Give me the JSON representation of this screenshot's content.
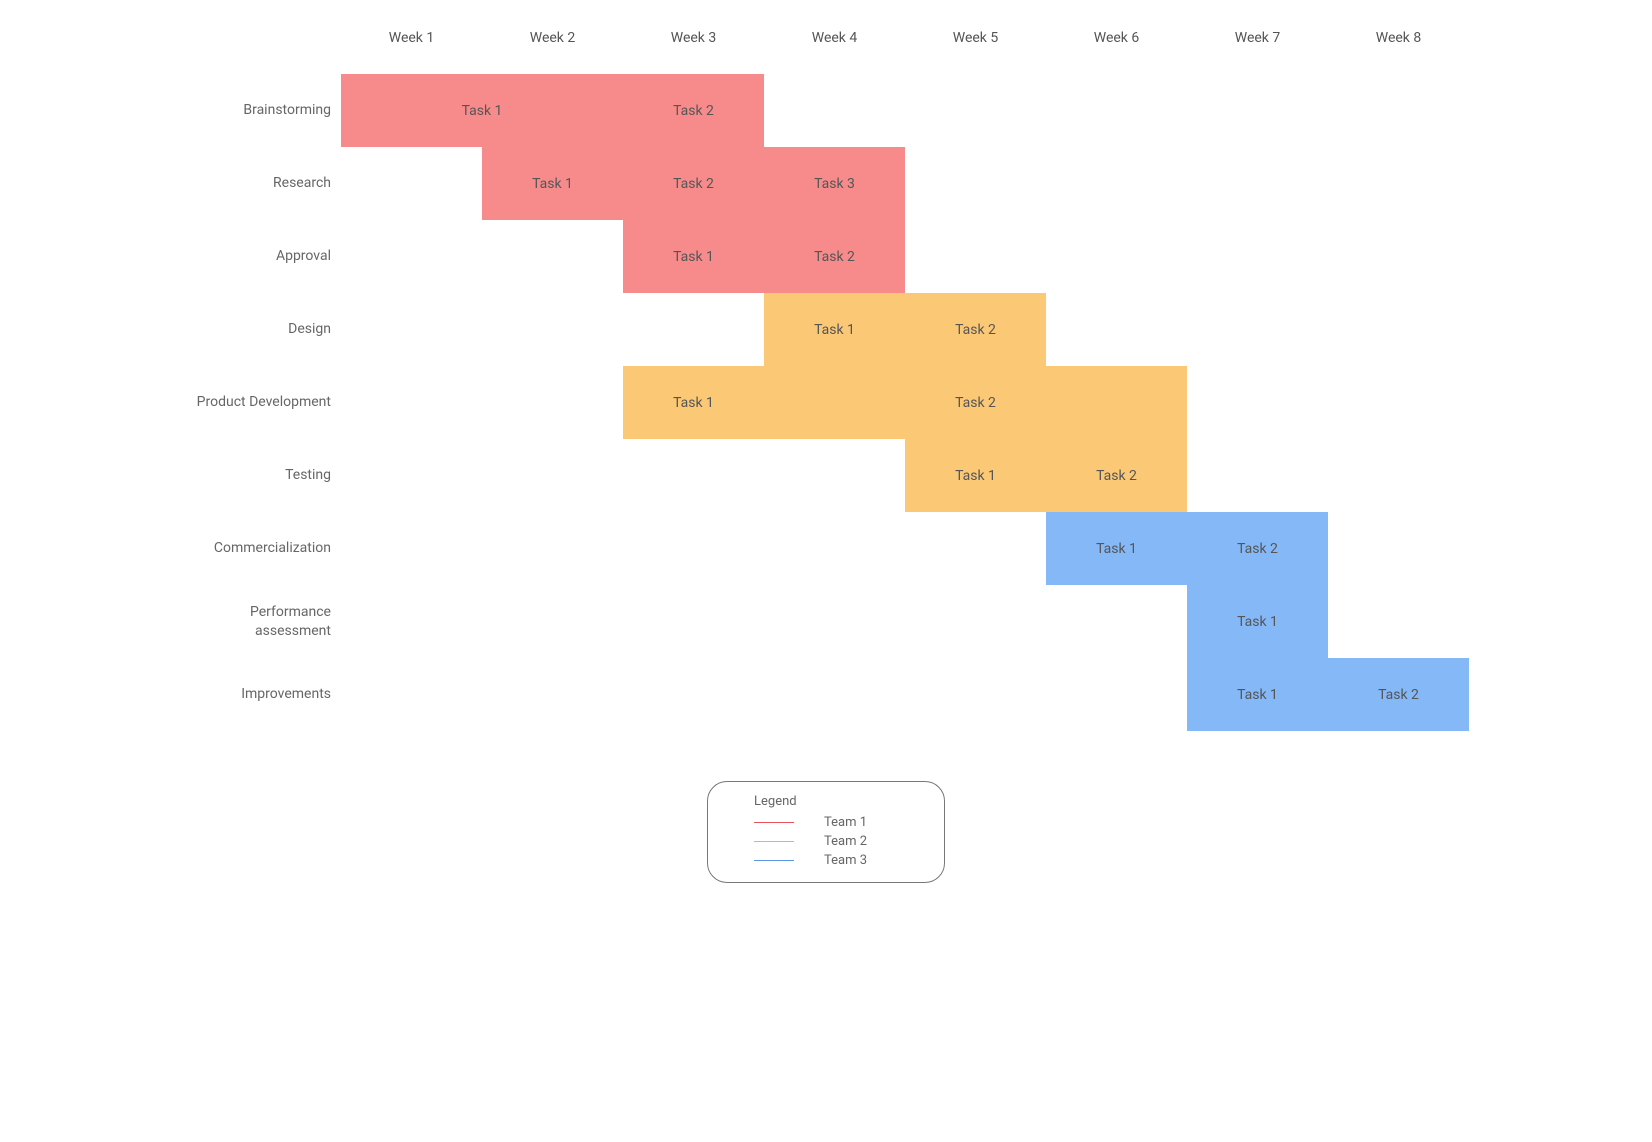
{
  "chart_data": {
    "type": "bar",
    "title": "",
    "xlabel": "",
    "ylabel": "",
    "x_categories": [
      "Week 1",
      "Week 2",
      "Week 3",
      "Week 4",
      "Week 5",
      "Week 6",
      "Week  7",
      "Week 8"
    ],
    "y_categories": [
      "Brainstorming",
      "Research",
      "Approval",
      "Design",
      "Product Development",
      "Testing",
      "Commercialization",
      "Performance assessment",
      "Improvements"
    ],
    "legend": {
      "title": "Legend",
      "items": [
        "Team 1",
        "Team 2",
        "Team 3"
      ]
    },
    "series": [
      {
        "row": "Brainstorming",
        "task": "Task 1",
        "team": "Team 1",
        "start_week": 1,
        "span_weeks": 2
      },
      {
        "row": "Brainstorming",
        "task": "Task 2",
        "team": "Team 1",
        "start_week": 3,
        "span_weeks": 1
      },
      {
        "row": "Research",
        "task": "Task 1",
        "team": "Team 1",
        "start_week": 2,
        "span_weeks": 1
      },
      {
        "row": "Research",
        "task": "Task 2",
        "team": "Team 1",
        "start_week": 3,
        "span_weeks": 1
      },
      {
        "row": "Research",
        "task": "Task 3",
        "team": "Team 1",
        "start_week": 4,
        "span_weeks": 1
      },
      {
        "row": "Approval",
        "task": "Task 1",
        "team": "Team 1",
        "start_week": 3,
        "span_weeks": 1
      },
      {
        "row": "Approval",
        "task": "Task 2",
        "team": "Team 1",
        "start_week": 4,
        "span_weeks": 1
      },
      {
        "row": "Design",
        "task": "Task 1",
        "team": "Team 2",
        "start_week": 4,
        "span_weeks": 1
      },
      {
        "row": "Design",
        "task": "Task 2",
        "team": "Team 2",
        "start_week": 5,
        "span_weeks": 1
      },
      {
        "row": "Product Development",
        "task": "Task 1",
        "team": "Team 2",
        "start_week": 3,
        "span_weeks": 1
      },
      {
        "row": "Product Development",
        "task": "Task 2",
        "team": "Team 2",
        "start_week": 4,
        "span_weeks": 3
      },
      {
        "row": "Testing",
        "task": "Task 1",
        "team": "Team 2",
        "start_week": 5,
        "span_weeks": 1
      },
      {
        "row": "Testing",
        "task": "Task 2",
        "team": "Team 2",
        "start_week": 6,
        "span_weeks": 1
      },
      {
        "row": "Commercialization",
        "task": "Task 1",
        "team": "Team 3",
        "start_week": 6,
        "span_weeks": 1
      },
      {
        "row": "Commercialization",
        "task": "Task 2",
        "team": "Team 3",
        "start_week": 7,
        "span_weeks": 1
      },
      {
        "row": "Performance assessment",
        "task": "Task 1",
        "team": "Team 3",
        "start_week": 7,
        "span_weeks": 1
      },
      {
        "row": "Improvements",
        "task": "Task 1",
        "team": "Team 3",
        "start_week": 7,
        "span_weeks": 1
      },
      {
        "row": "Improvements",
        "task": "Task 2",
        "team": "Team 3",
        "start_week": 8,
        "span_weeks": 1
      }
    ],
    "colors": {
      "Team 1": "#f78b8b",
      "Team 2": "#fbc875",
      "Team 3": "#84b8f7"
    }
  }
}
